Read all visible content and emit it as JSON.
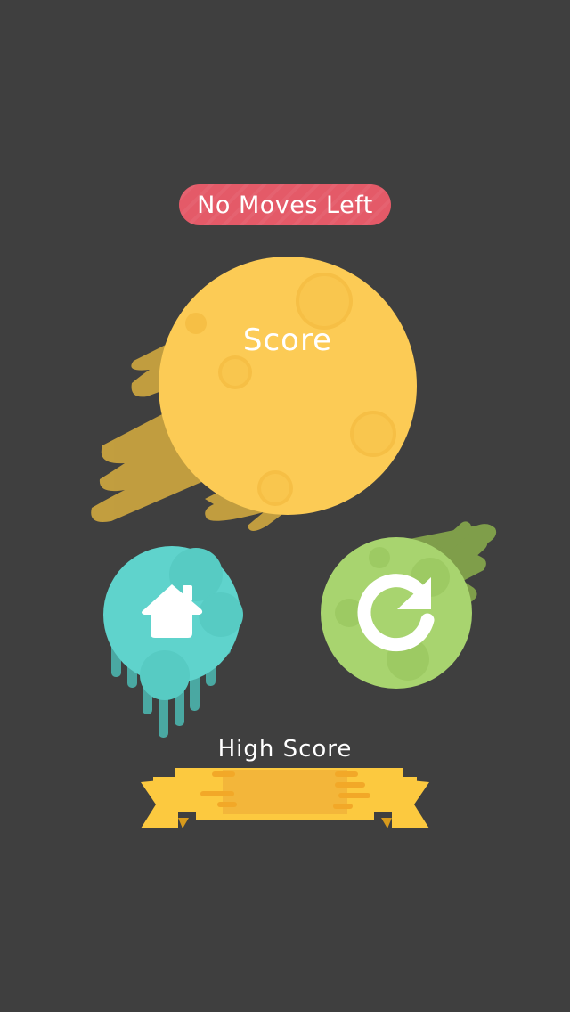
{
  "status": {
    "message": "No Moves Left"
  },
  "score": {
    "label": "Score",
    "value": ""
  },
  "high_score": {
    "label": "High Score",
    "value": ""
  },
  "buttons": {
    "home": "home",
    "restart": "restart"
  },
  "colors": {
    "background": "#3f3f3f",
    "banner": "#e45a68",
    "moon": "#fccb55",
    "home_button": "#5fd3cc",
    "restart_button": "#a8d46f",
    "ribbon": "#fcc93f"
  },
  "icons": [
    "home-icon",
    "restart-icon"
  ]
}
